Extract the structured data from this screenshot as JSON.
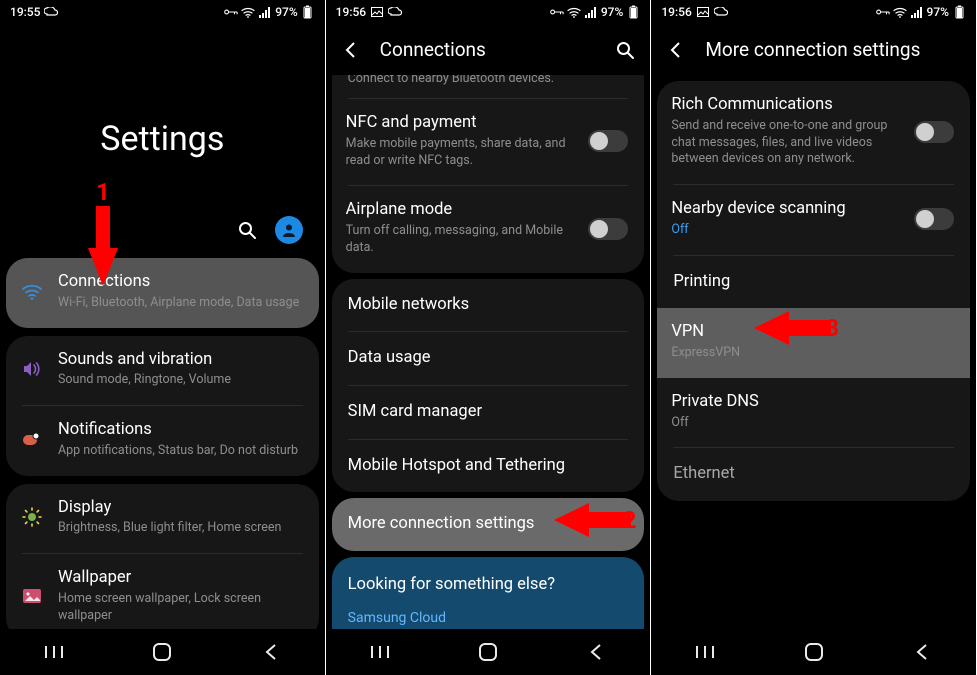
{
  "status": {
    "time1": "19:55",
    "time2": "19:56",
    "time3": "19:56",
    "battery": "97%"
  },
  "screen1": {
    "title": "Settings",
    "annotation_num": "1",
    "items": [
      {
        "title": "Connections",
        "sub": "Wi-Fi, Bluetooth, Airplane mode, Data usage"
      },
      {
        "title": "Sounds and vibration",
        "sub": "Sound mode, Ringtone, Volume"
      },
      {
        "title": "Notifications",
        "sub": "App notifications, Status bar, Do not disturb"
      },
      {
        "title": "Display",
        "sub": "Brightness, Blue light filter, Home screen"
      },
      {
        "title": "Wallpaper",
        "sub": "Home screen wallpaper, Lock screen wallpaper"
      }
    ]
  },
  "screen2": {
    "header": "Connections",
    "top_truncated": "Connect to nearby Bluetooth devices.",
    "annotation_num": "2",
    "nfc": {
      "title": "NFC and payment",
      "sub": "Make mobile payments, share data, and read or write NFC tags."
    },
    "airplane": {
      "title": "Airplane mode",
      "sub": "Turn off calling, messaging, and Mobile data."
    },
    "items": [
      "Mobile networks",
      "Data usage",
      "SIM card manager",
      "Mobile Hotspot and Tethering"
    ],
    "more": "More connection settings",
    "looking": {
      "title": "Looking for something else?",
      "link": "Samsung Cloud"
    }
  },
  "screen3": {
    "header": "More connection settings",
    "annotation_num": "3",
    "rich": {
      "title": "Rich Communications",
      "sub": "Send and receive one-to-one and group chat messages, files, and live videos between devices on any network."
    },
    "nearby": {
      "title": "Nearby device scanning",
      "sub": "Off"
    },
    "printing": "Printing",
    "vpn": {
      "title": "VPN",
      "sub": "ExpressVPN"
    },
    "dns": {
      "title": "Private DNS",
      "sub": "Off"
    },
    "ethernet": "Ethernet"
  }
}
